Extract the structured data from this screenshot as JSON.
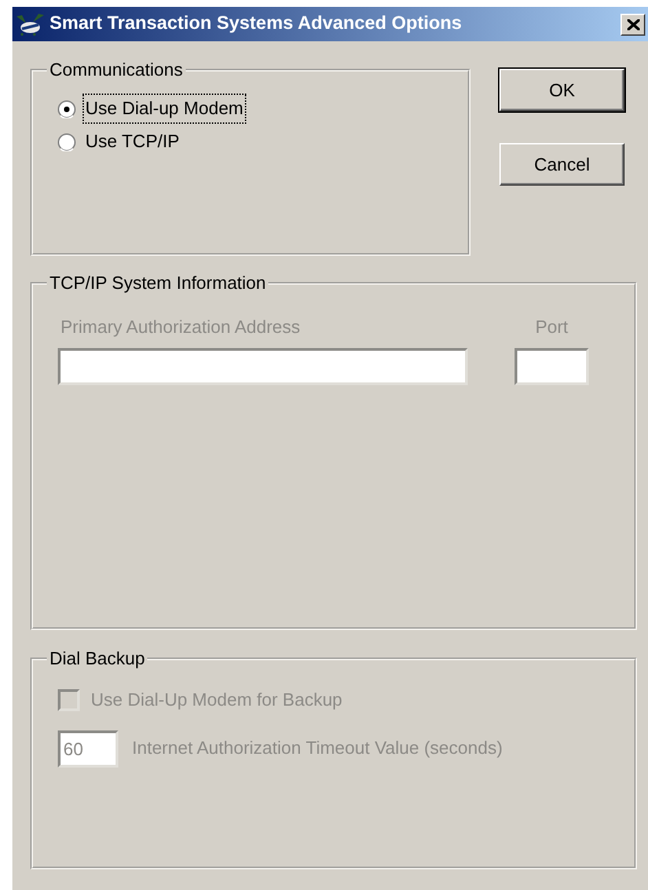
{
  "window": {
    "title": "Smart Transaction Systems Advanced Options"
  },
  "communications": {
    "title": "Communications",
    "options": [
      {
        "label": "Use Dial-up Modem",
        "selected": true,
        "focused": true
      },
      {
        "label": "Use TCP/IP",
        "selected": false,
        "focused": false
      }
    ]
  },
  "buttons": [
    {
      "label": "OK",
      "default": true
    },
    {
      "label": "Cancel",
      "default": false
    }
  ],
  "tcpip": {
    "title": "TCP/IP System Information",
    "fields": [
      {
        "kind": "address",
        "label": "Primary Authorization Address",
        "disabled": true
      },
      {
        "kind": "port",
        "label": "Port",
        "disabled": true
      }
    ]
  },
  "dial_backup": {
    "title": "Dial Backup",
    "checkbox": {
      "label": "Use Dial-Up Modem for Backup",
      "checked": false,
      "disabled": true
    },
    "timeout": {
      "label": "Internet Authorization Timeout Value (seconds)",
      "value": "60",
      "disabled": true
    }
  }
}
